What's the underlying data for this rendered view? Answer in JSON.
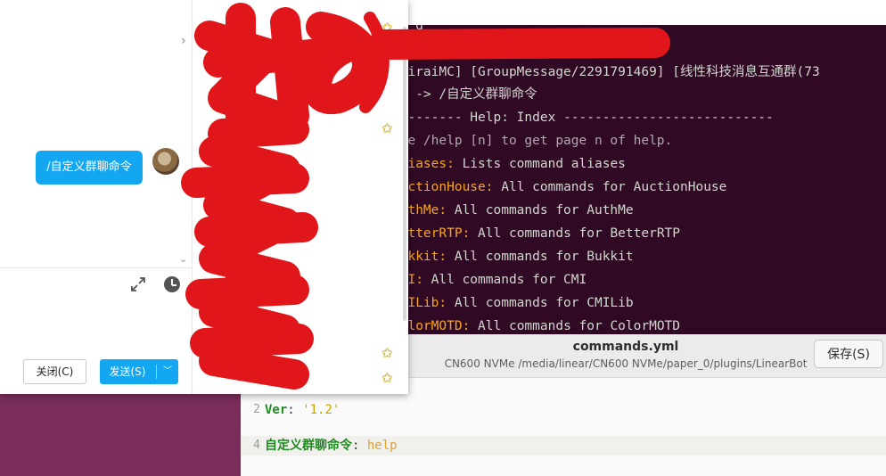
{
  "terminal": {
    "lines": [
      {
        "text": "-> g"
      },
      {
        "text": "[MiraiMC] [GroupMessage/2291791469] [线性科技消息互通群(73"
      },
      {
        "text": "5) -> /自定义群聊命令"
      },
      {
        "text": "--------- Help: Index ---------------------------"
      },
      {
        "text": "Use /help [n] to get page n of help."
      }
    ],
    "help_entries": [
      {
        "name": "Aliases:",
        "desc": " Lists command aliases"
      },
      {
        "name": "AuctionHouse:",
        "desc": " All commands for AuctionHouse"
      },
      {
        "name": "AuthMe:",
        "desc": " All commands for AuthMe"
      },
      {
        "name": "BetterRTP:",
        "desc": " All commands for BetterRTP"
      },
      {
        "name": "Bukkit:",
        "desc": " All commands for Bukkit"
      },
      {
        "name": "CMI:",
        "desc": " All commands for CMI"
      },
      {
        "name": "CMILib:",
        "desc": " All commands for CMILib"
      },
      {
        "name": "ColorMOTD:",
        "desc": " All commands for ColorMOTD"
      }
    ],
    "colors": {
      "background": "#300a24",
      "keyword": "#f5a623"
    }
  },
  "editor": {
    "file_title": "commands.yml",
    "file_path": "CN600 NVMe /media/linear/CN600 NVMe/paper_0/plugins/LinearBot",
    "save_label": "保存(S)",
    "code": {
      "line2_num": "2",
      "line2_key": "Ver",
      "line2_colon": ": ",
      "line2_val": "'1.2'",
      "line4_num": "4",
      "line4_key": "自定义群聊命令",
      "line4_colon": ": ",
      "line4_val": "help"
    }
  },
  "chat": {
    "message": "/自定义群聊命令",
    "close_label": "关闭(C)",
    "send_label": "发送(S)",
    "icons": [
      "expand-icon",
      "clock-icon",
      "chevron-down-icon",
      "star-icon"
    ],
    "colors": {
      "accent": "#12a7f0"
    }
  }
}
